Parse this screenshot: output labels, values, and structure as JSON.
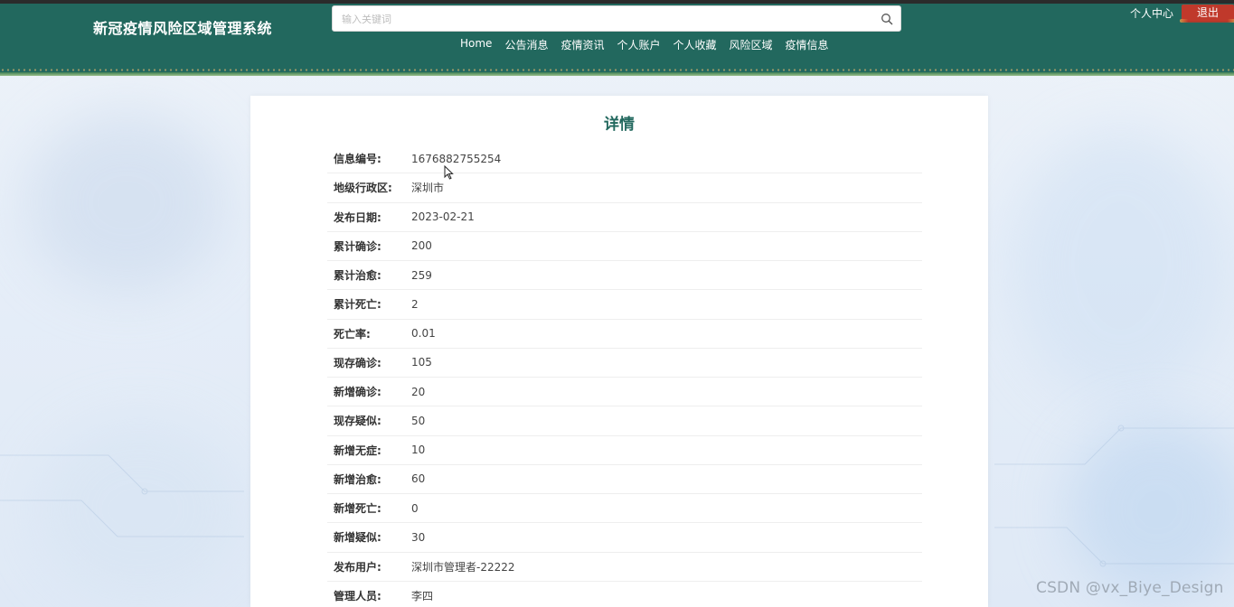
{
  "header": {
    "site_title": "新冠疫情风险区域管理系统",
    "search_placeholder": "输入关键词",
    "user_center": "个人中心",
    "logout": "退出",
    "nav": [
      "Home",
      "公告消息",
      "疫情资讯",
      "个人账户",
      "个人收藏",
      "风险区域",
      "疫情信息"
    ]
  },
  "detail": {
    "title": "详情",
    "fields": [
      {
        "label": "信息编号:",
        "value": "1676882755254"
      },
      {
        "label": "地级行政区:",
        "value": "深圳市"
      },
      {
        "label": "发布日期:",
        "value": "2023-02-21"
      },
      {
        "label": "累计确诊:",
        "value": "200"
      },
      {
        "label": "累计治愈:",
        "value": "259"
      },
      {
        "label": "累计死亡:",
        "value": "2"
      },
      {
        "label": "死亡率:",
        "value": "0.01"
      },
      {
        "label": "现存确诊:",
        "value": "105"
      },
      {
        "label": "新增确诊:",
        "value": "20"
      },
      {
        "label": "现存疑似:",
        "value": "50"
      },
      {
        "label": "新增无症:",
        "value": "10"
      },
      {
        "label": "新增治愈:",
        "value": "60"
      },
      {
        "label": "新增死亡:",
        "value": "0"
      },
      {
        "label": "新增疑似:",
        "value": "30"
      },
      {
        "label": "发布用户:",
        "value": "深圳市管理者-22222"
      },
      {
        "label": "管理人员:",
        "value": "李四"
      }
    ]
  },
  "watermark": "CSDN @vx_Biye_Design",
  "colors": {
    "header_bg": "#22685e",
    "title_color": "#22685e",
    "logout_bg": "#c0392b"
  }
}
